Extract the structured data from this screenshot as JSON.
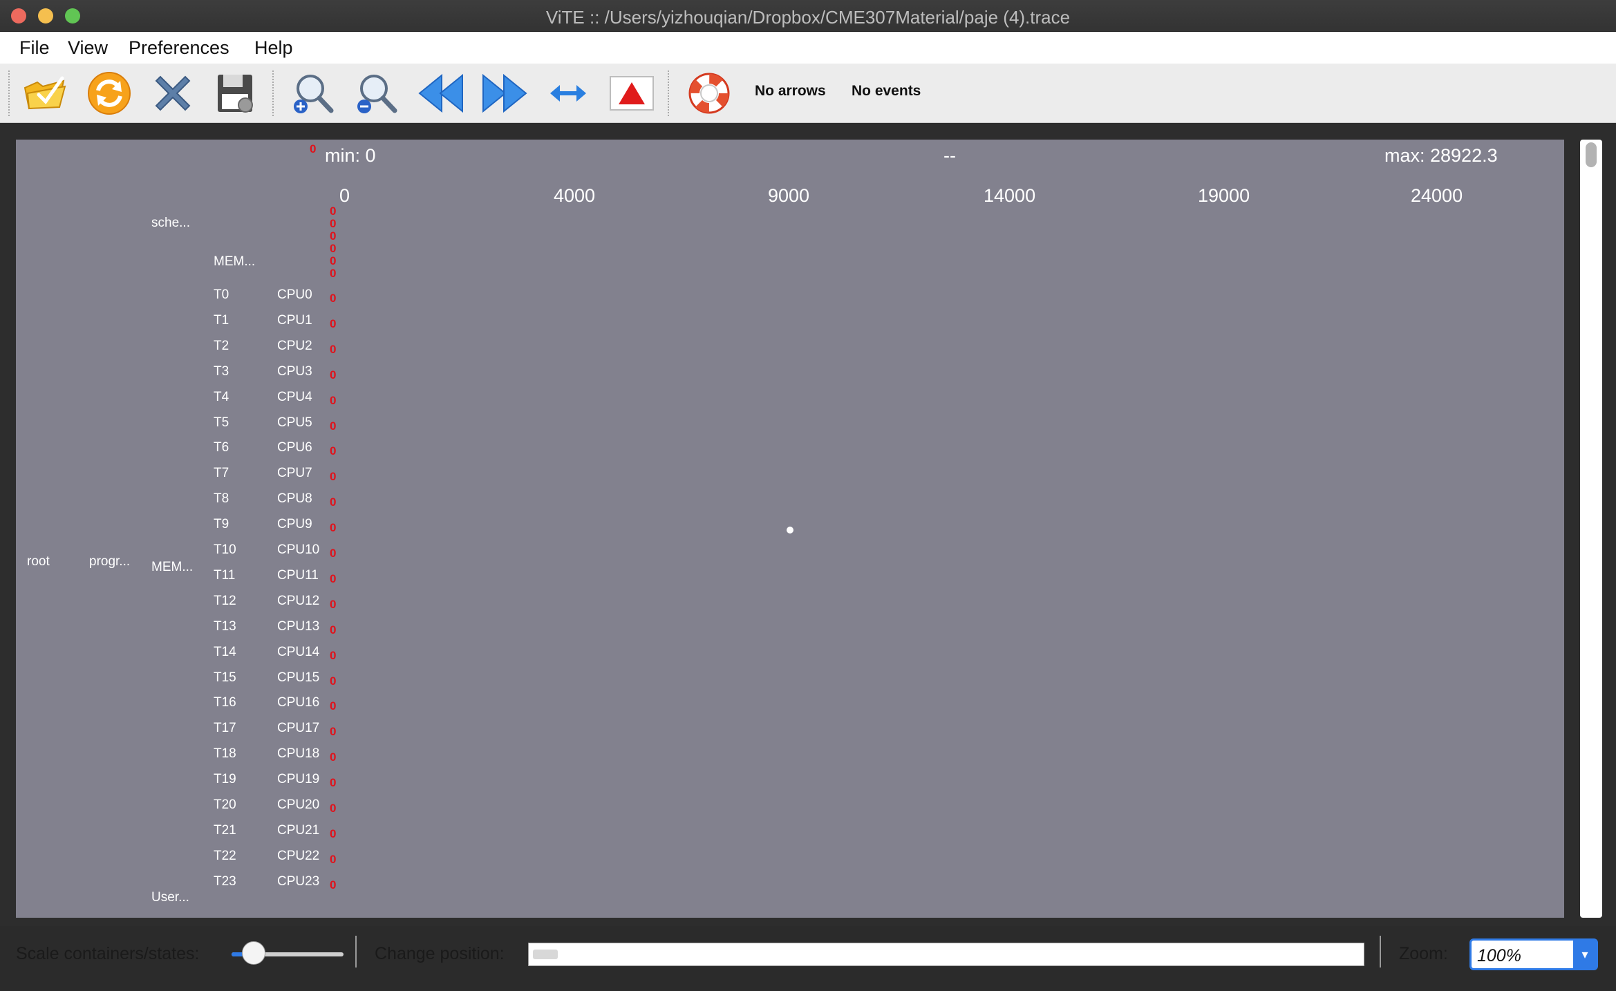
{
  "window": {
    "title": "ViTE :: /Users/yizhouqian/Dropbox/CME307Material/paje (4).trace"
  },
  "menu": {
    "file": "File",
    "view": "View",
    "preferences": "Preferences",
    "help": "Help"
  },
  "toolbar": {
    "icons": [
      "open-folder-icon",
      "reload-icon",
      "close-icon",
      "save-icon",
      "zoom-in-icon",
      "zoom-out-icon",
      "goto-start-icon",
      "goto-end-icon",
      "fit-width-icon",
      "show-states-icon",
      "help-icon"
    ],
    "arrows_label": "No arrows",
    "events_label": "No events"
  },
  "timeline": {
    "min_label": "min: 0",
    "mid_label": "--",
    "max_label": "max: 28922.3",
    "small_zero": "0",
    "ticks": [
      "0",
      "4000",
      "9000",
      "14000",
      "19000",
      "24000"
    ],
    "zero_marker": "0"
  },
  "containers": {
    "root": "root",
    "program": "progr...",
    "scheduler": "sche...",
    "mem_upper": "MEM...",
    "mem_main": "MEM...",
    "user": "User...",
    "threads": [
      {
        "t": "T0",
        "cpu": "CPU0"
      },
      {
        "t": "T1",
        "cpu": "CPU1"
      },
      {
        "t": "T2",
        "cpu": "CPU2"
      },
      {
        "t": "T3",
        "cpu": "CPU3"
      },
      {
        "t": "T4",
        "cpu": "CPU4"
      },
      {
        "t": "T5",
        "cpu": "CPU5"
      },
      {
        "t": "T6",
        "cpu": "CPU6"
      },
      {
        "t": "T7",
        "cpu": "CPU7"
      },
      {
        "t": "T8",
        "cpu": "CPU8"
      },
      {
        "t": "T9",
        "cpu": "CPU9"
      },
      {
        "t": "T10",
        "cpu": "CPU10"
      },
      {
        "t": "T11",
        "cpu": "CPU11"
      },
      {
        "t": "T12",
        "cpu": "CPU12"
      },
      {
        "t": "T13",
        "cpu": "CPU13"
      },
      {
        "t": "T14",
        "cpu": "CPU14"
      },
      {
        "t": "T15",
        "cpu": "CPU15"
      },
      {
        "t": "T16",
        "cpu": "CPU16"
      },
      {
        "t": "T17",
        "cpu": "CPU17"
      },
      {
        "t": "T18",
        "cpu": "CPU18"
      },
      {
        "t": "T19",
        "cpu": "CPU19"
      },
      {
        "t": "T20",
        "cpu": "CPU20"
      },
      {
        "t": "T21",
        "cpu": "CPU21"
      },
      {
        "t": "T22",
        "cpu": "CPU22"
      },
      {
        "t": "T23",
        "cpu": "CPU23"
      }
    ]
  },
  "bottom": {
    "scale_label": "Scale containers/states:",
    "scale_level": 0.2,
    "position_label": "Change position:",
    "zoom_label": "Zoom:",
    "zoom_value": "100%"
  },
  "colors": {
    "canvas": "#82818e",
    "marker": "#e0121b",
    "accent": "#2f7ae6"
  }
}
